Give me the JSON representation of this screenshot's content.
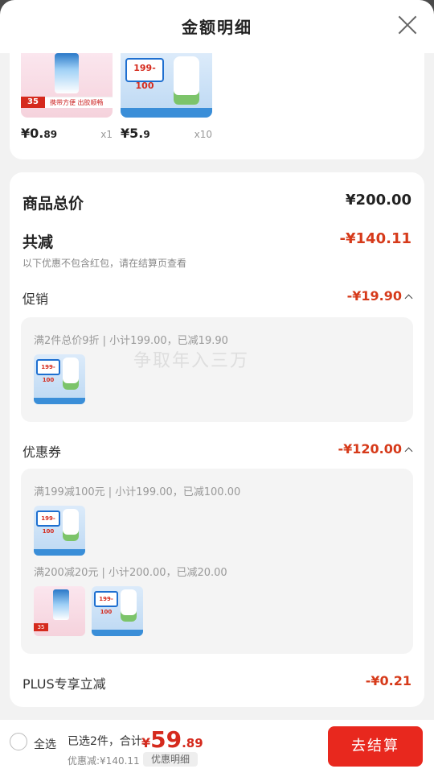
{
  "header": {
    "title": "金额明细"
  },
  "products": [
    {
      "price_main": "¥0.",
      "price_dec": "89",
      "qty": "x1",
      "tag": "35",
      "strip": "携带方便 出胶顺畅"
    },
    {
      "price_main": "¥5.",
      "price_dec": "9",
      "qty": "x10",
      "banner": "199-100"
    }
  ],
  "summary": {
    "total_label": "商品总价",
    "total_value": "¥200.00",
    "reduce_label": "共减",
    "reduce_value": "-¥140.11",
    "reduce_hint": "以下优惠不包含红包，请在结算页查看",
    "promo_label": "促销",
    "promo_value": "-¥19.90",
    "promo_line": "满2件总价9折 | 小计199.00，已减19.90",
    "coupon_label": "优惠券",
    "coupon_value": "-¥120.00",
    "coupon_line1": "满199减100元 | 小计199.00，已减100.00",
    "coupon_line2": "满200减20元 | 小计200.00，已减20.00",
    "plus_label": "PLUS专享立减",
    "plus_value": "-¥0.21",
    "mini_banner": "199-100",
    "mini_tag": "35"
  },
  "watermark": "争取年入三万",
  "bottom": {
    "select_all": "全选",
    "selected_text": "已选2件，合计:",
    "total_symbol": "¥",
    "total_big": "59",
    "total_small": ".89",
    "discount_text": "优惠减:¥140.11",
    "detail_button": "优惠明细",
    "checkout_button": "去结算"
  },
  "colors": {
    "accent": "#e8281e",
    "discount": "#d63a1a"
  }
}
